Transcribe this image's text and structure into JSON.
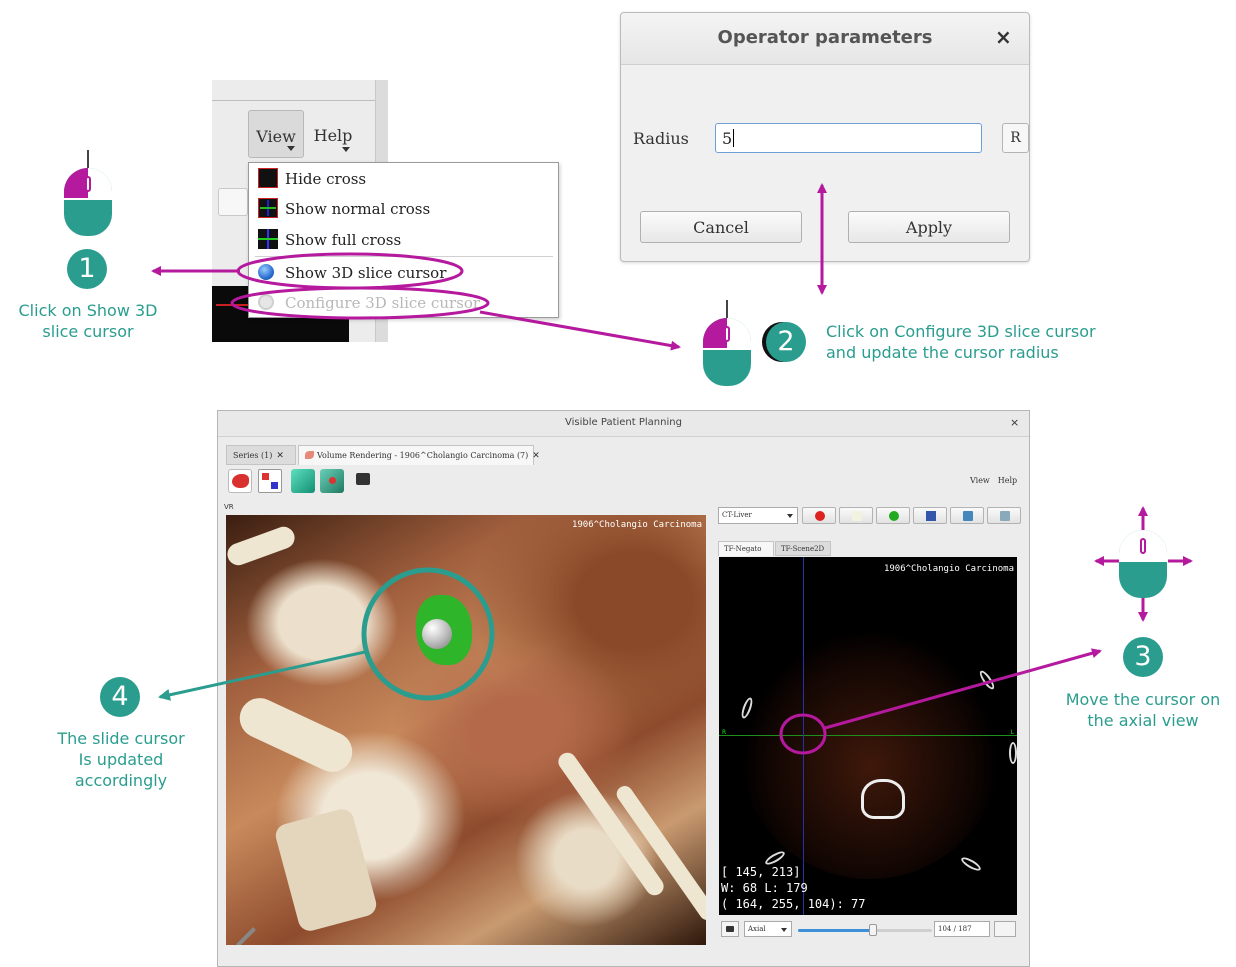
{
  "menu_crop": {
    "menubar": {
      "view": "View",
      "help": "Help"
    },
    "items": [
      {
        "label": "Hide cross",
        "icon": "hide-cross-icon",
        "enabled": true
      },
      {
        "label": "Show normal cross",
        "icon": "normal-cross-icon",
        "enabled": true
      },
      {
        "label": "Show full cross",
        "icon": "full-cross-icon",
        "enabled": true
      },
      {
        "label": "Show 3D slice cursor",
        "icon": "globe-icon",
        "enabled": true
      },
      {
        "label": "Configure 3D slice cursor",
        "icon": "gear-icon",
        "enabled": false
      }
    ]
  },
  "dialog": {
    "title": "Operator parameters",
    "close": "×",
    "radius_label": "Radius",
    "radius_value": "5",
    "reset_button": "R",
    "cancel": "Cancel",
    "apply": "Apply"
  },
  "annotations": {
    "step1": {
      "number": "1",
      "text_line1": "Click on Show 3D",
      "text_line2": "slice cursor"
    },
    "step2": {
      "number": "2",
      "text_line1": "Click on Configure 3D slice cursor",
      "text_line2": "and update the cursor radius"
    },
    "step3": {
      "number": "3",
      "text_line1": "Move the cursor on",
      "text_line2": "the axial view"
    },
    "step4": {
      "number": "4",
      "text_line1": "The slide cursor",
      "text_line2": "Is updated",
      "text_line3": "accordingly"
    },
    "colors": {
      "teal": "#2a9d8f",
      "magenta": "#b5199d"
    }
  },
  "app": {
    "title": "Visible Patient Planning",
    "close": "×",
    "tabs": [
      {
        "label": "Series (1)",
        "active": false
      },
      {
        "label": "Volume Rendering - 1906^Cholangio Carcinoma (7)",
        "active": true
      }
    ],
    "view_menu": "View",
    "help_menu": "Help",
    "vr_label": "VR",
    "vr_view_label": "1906^Cholangio Carcinoma",
    "tf_preset": "CT-Liver",
    "right_tabs": [
      {
        "label": "TF-Negato",
        "active": true
      },
      {
        "label": "TF-Scene2D",
        "active": false
      }
    ],
    "axial": {
      "patient_label": "1906^Cholangio Carcinoma",
      "left_marker": "R",
      "right_marker": "L",
      "info_line1": "[ 145, 213]",
      "info_line2": "W: 68 L: 179",
      "info_line3": "( 164, 255, 104): 77"
    },
    "bottom": {
      "orientation": "Axial",
      "slice": "104 / 187",
      "slice_fraction": 0.556
    }
  }
}
